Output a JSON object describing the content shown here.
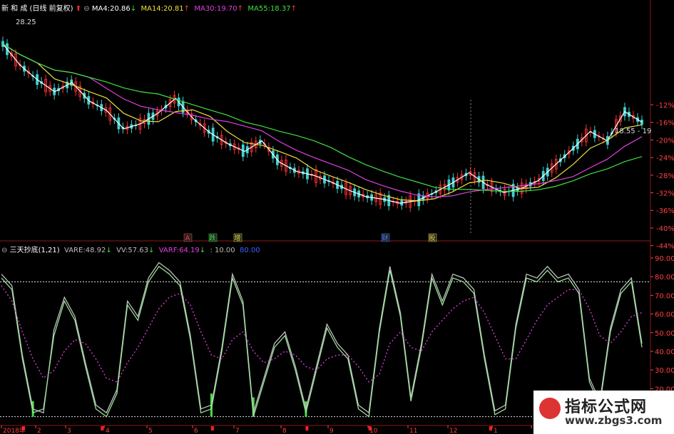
{
  "upper_header": {
    "stock_name": "新 和 成",
    "adjust_mode": "(日线 前复权)",
    "ma4": {
      "label": "MA4:",
      "value": "20.86",
      "arrow": "↓",
      "color": "#ffffff"
    },
    "ma14": {
      "label": "MA14:",
      "value": "20.81",
      "arrow": "↑",
      "color": "#f0e040"
    },
    "ma30": {
      "label": "MA30:",
      "value": "19.70",
      "arrow": "↑",
      "color": "#e040e0"
    },
    "ma55": {
      "label": "MA55:",
      "value": "18.37",
      "arrow": "↑",
      "color": "#40e040"
    }
  },
  "price_high_label": "28.25",
  "last_price_label": "18.55 - 19",
  "upper_axis_ticks": [
    "-12%",
    "-16%",
    "-20%",
    "-24%",
    "-28%",
    "-32%",
    "-36%",
    "-40%",
    "-44%"
  ],
  "upper_axis_color": "#ff4040",
  "event_markers": [
    {
      "text": "A",
      "color": "#ff4040"
    },
    {
      "text": "跌",
      "color": "#40e040"
    },
    {
      "text": "增",
      "color": "#f0e040"
    },
    {
      "text": "财",
      "color": "#4080ff"
    },
    {
      "text": "股",
      "color": "#f0e040"
    }
  ],
  "lower_header": {
    "indicator_name": "三天抄底(1,21)",
    "vare": {
      "label": "VARE:",
      "value": "48.92",
      "arrow": "↓",
      "color": "#c0c0c0"
    },
    "vv": {
      "label": "VV:",
      "value": "57.63",
      "arrow": "↓",
      "color": "#c0c0c0"
    },
    "varf": {
      "label": "VARF:",
      "value": "64.19",
      "arrow": "↓",
      "color": "#e040e0"
    },
    "extra1": {
      "value": ": 10.00",
      "color": "#c0c0c0"
    },
    "extra2": {
      "value": "80.00",
      "color": "#4060ff"
    }
  },
  "lower_axis_ticks": [
    "90.00",
    "80.00",
    "70.00",
    "60.00",
    "50.00",
    "40.00",
    "30.00",
    "20.00",
    "10.00"
  ],
  "date_axis_labels": [
    "2018年",
    "2",
    "3",
    "4",
    "5",
    "6",
    "7",
    "8",
    "9",
    "10",
    "11",
    "12",
    "1",
    "2"
  ],
  "watermark": {
    "title": "指标公式网",
    "url": "www.zbgs3.com"
  },
  "chart_data": [
    {
      "type": "line",
      "panel": "price",
      "title": "",
      "price_labels": {
        "high": 28.25
      },
      "series": [
        {
          "name": "MA4",
          "color": "#ffffff"
        },
        {
          "name": "MA14",
          "color": "#f0e040"
        },
        {
          "name": "MA30",
          "color": "#e040e0"
        },
        {
          "name": "MA55",
          "color": "#40e040"
        }
      ],
      "close_path": [
        26.8,
        25.2,
        24.1,
        23.2,
        23.9,
        22.5,
        21.8,
        20.4,
        20.8,
        21.6,
        22.7,
        21.2,
        20.1,
        19.3,
        18.7,
        19.5,
        17.9,
        17.2,
        16.9,
        16.4,
        15.8,
        15.3,
        15.1,
        14.8,
        15.0,
        15.6,
        16.3,
        17.1,
        16.2,
        15.6,
        15.9,
        16.5,
        17.7,
        18.9,
        20.2,
        19.5,
        21.7,
        20.9
      ]
    },
    {
      "type": "line",
      "panel": "indicator",
      "title": "三天抄底(1,21)",
      "ylim": [
        8,
        95
      ],
      "series": [
        {
          "name": "VARE",
          "color": "#c0c0c0",
          "values": [
            84,
            78,
            42,
            14,
            12,
            55,
            72,
            62,
            38,
            16,
            12,
            24,
            70,
            62,
            82,
            90,
            86,
            80,
            52,
            14,
            16,
            46,
            84,
            70,
            12,
            30,
            48,
            54,
            36,
            14,
            36,
            58,
            48,
            42,
            16,
            12,
            56,
            88,
            64,
            20,
            48,
            84,
            70,
            84,
            82,
            76,
            42,
            13,
            16,
            58,
            84,
            82,
            88,
            82,
            84,
            76,
            30,
            18,
            56,
            76,
            82,
            48
          ]
        },
        {
          "name": "VV",
          "color": "#9ae09a",
          "values": [
            82,
            76,
            40,
            12,
            14,
            52,
            70,
            60,
            36,
            14,
            10,
            22,
            68,
            60,
            80,
            88,
            84,
            78,
            50,
            12,
            14,
            44,
            82,
            68,
            10,
            28,
            46,
            52,
            34,
            12,
            34,
            56,
            46,
            40,
            14,
            10,
            54,
            86,
            62,
            18,
            46,
            82,
            68,
            82,
            80,
            74,
            40,
            11,
            14,
            56,
            82,
            80,
            86,
            80,
            82,
            74,
            28,
            16,
            54,
            74,
            80,
            46
          ]
        },
        {
          "name": "VARF",
          "color": "#e040e0",
          "values": [
            78,
            70,
            54,
            40,
            30,
            34,
            44,
            50,
            48,
            40,
            30,
            28,
            38,
            46,
            56,
            66,
            72,
            74,
            68,
            54,
            42,
            40,
            50,
            54,
            44,
            38,
            40,
            44,
            42,
            36,
            34,
            40,
            42,
            42,
            36,
            28,
            32,
            48,
            54,
            46,
            44,
            54,
            60,
            66,
            70,
            72,
            64,
            52,
            40,
            40,
            50,
            60,
            68,
            72,
            76,
            76,
            66,
            52,
            48,
            54,
            62,
            64
          ]
        },
        {
          "name": "signal",
          "color": "#40e040",
          "values": [
            0,
            0,
            0,
            18,
            0,
            0,
            0,
            0,
            0,
            0,
            0,
            0,
            0,
            0,
            0,
            0,
            0,
            0,
            0,
            0,
            22,
            0,
            0,
            0,
            20,
            0,
            0,
            0,
            0,
            18,
            0,
            0,
            0,
            0,
            0,
            0,
            0,
            0,
            0,
            0,
            0,
            0,
            0,
            0,
            0,
            0,
            0,
            0,
            0,
            0,
            0,
            0,
            0,
            0,
            0,
            0,
            0,
            0,
            0,
            0,
            0,
            0
          ]
        }
      ],
      "reference_lines": [
        80,
        10
      ]
    }
  ]
}
